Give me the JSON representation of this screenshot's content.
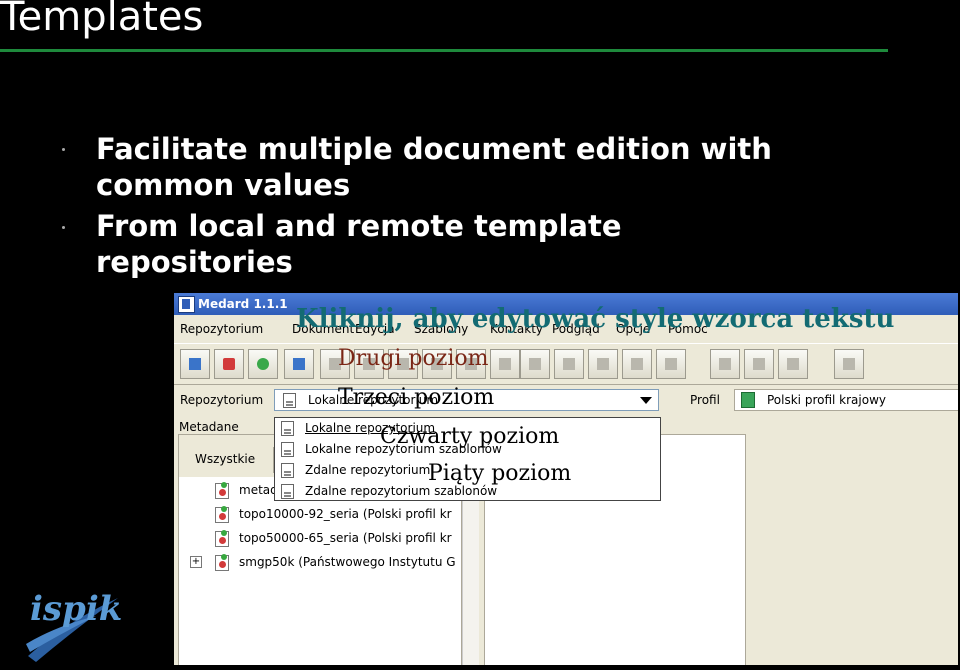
{
  "slide": {
    "title": "Templates",
    "bullets": [
      {
        "line1": "Facilitate multiple document edition with",
        "line2": "common values"
      },
      {
        "line1": "From local and remote template",
        "line2": "repositories"
      }
    ],
    "accent_color": "#1e8a3c",
    "logo_text": "ispik"
  },
  "app": {
    "title": "Medard 1.1.1",
    "menu": [
      "Repozytorium",
      "Dokument",
      "Edycja",
      "Szablony",
      "Kontakty",
      "Podgląd",
      "Opcje",
      "Pomoc"
    ],
    "repo_label": "Repozytorium",
    "repo_selected": "Lokalne repozytorium",
    "profile_label": "Profil",
    "profile_value": "Polski profil krajowy",
    "metadata_title": "Metadane",
    "filter_label": "Wszystkie",
    "tree": [
      "metad",
      "topo10000-92_seria (Polski profil kr",
      "topo50000-65_seria (Polski profil kr",
      "smgp50k (Państwowego Instytutu G"
    ],
    "dropdown_options": [
      "Lokalne repozytorium",
      "Lokalne repozytorium szablonów",
      "Zdalne repozytorium",
      "Zdalne repozytorium szablonów"
    ]
  },
  "overlay": {
    "level1": "Kliknij, aby edytować style wzorca tekstu",
    "level2": "Drugi poziom",
    "level3": "Trzeci poziom",
    "level4": "Czwarty poziom",
    "level5": "Piąty poziom"
  }
}
